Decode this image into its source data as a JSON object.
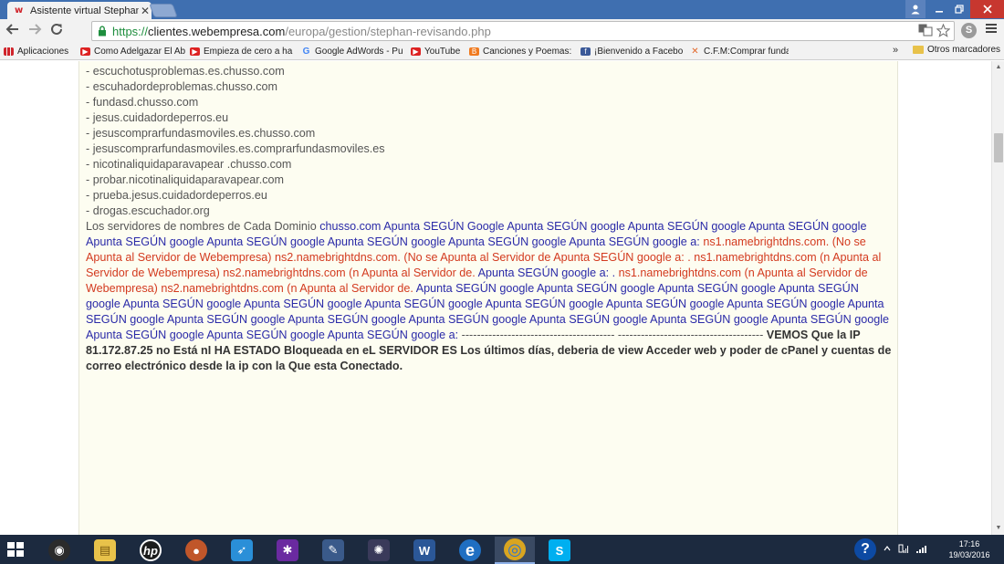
{
  "browser": {
    "tab_title": "Asistente virtual Stephan",
    "tab_close": "✕",
    "favicon": "w",
    "url_scheme": "https://",
    "url_host": "clientes.webempresa.com",
    "url_path": "/europa/gestion/stephan-revisando.php",
    "bookmarks": [
      {
        "label": "Aplicaciones",
        "icon": "apps-grid-icon"
      },
      {
        "label": "Como Adelgazar El Ab",
        "icon": "youtube-icon"
      },
      {
        "label": "Empieza de cero a ha",
        "icon": "youtube-icon"
      },
      {
        "label": "Google AdWords - Pu",
        "icon": "google-icon"
      },
      {
        "label": "YouTube",
        "icon": "youtube-icon"
      },
      {
        "label": "Canciones y Poemas:",
        "icon": "blogger-icon"
      },
      {
        "label": "¡Bienvenido a Facebo",
        "icon": "facebook-icon"
      },
      {
        "label": "C.F.M:Comprar funda",
        "icon": "cfm-icon"
      }
    ],
    "bookmarks_more": "»",
    "other_bookmarks": "Otros marcadores"
  },
  "content": {
    "list_items": [
      "- escuchotusproblemas.es.chusso.com",
      "- escuhadordeproblemas.chusso.com",
      "- fundasd.chusso.com",
      "- jesus.cuidadordeperros.eu",
      "- jesuscomprarfundasmoviles.es.chusso.com",
      "- jesuscomprarfundasmoviles.es.comprarfundasmoviles.es",
      "- nicotinaliquidaparavapear .chusso.com",
      "- probar.nicotinaliquidaparavapear.com",
      "- prueba.jesus.cuidadordeperros.eu",
      "- drogas.escuchador.org"
    ],
    "paragraph": [
      {
        "style": "grey",
        "text": "Los servidores de nombres de Cada Dominio "
      },
      {
        "style": "blue",
        "text": "chusso.com Apunta SEGÚN Google Apunta SEGÚN google Apunta SEGÚN google Apunta SEGÚN google Apunta SEGÚN google Apunta SEGÚN google Apunta SEGÚN google Apunta SEGÚN google Apunta SEGÚN google a: "
      },
      {
        "style": "red",
        "text": "ns1.namebrightdns.com. (No se Apunta al Servidor de Webempresa) ns2.namebrightdns.com. (No se Apunta al Servidor de Apunta SEGÚN google a: . ns1.namebrightdns.com (n Apunta al Servidor de Webempresa) ns2.namebrightdns.com (n Apunta al Servidor de. "
      },
      {
        "style": "blue",
        "text": "Apunta SEGÚN google a: . "
      },
      {
        "style": "red",
        "text": "ns1.namebrightdns.com (n Apunta al Servidor de Webempresa) ns2.namebrightdns.com (n Apunta al Servidor de. "
      },
      {
        "style": "blue",
        "text": "Apunta SEGÚN google Apunta SEGÚN google Apunta SEGÚN google Apunta SEGÚN google Apunta SEGÚN google Apunta SEGÚN google Apunta SEGÚN google Apunta SEGÚN google Apunta SEGÚN google Apunta SEGÚN google Apunta SEGÚN google Apunta SEGÚN google Apunta SEGÚN google Apunta SEGÚN google Apunta SEGÚN google Apunta SEGÚN google Apunta SEGÚN google Apunta SEGÚN google Apunta SEGÚN google Apunta SEGÚN google a: "
      },
      {
        "style": "grey",
        "text": "---------------------------------------- -------------------------------------- "
      },
      {
        "style": "bold",
        "text": "VEMOS Que la IP 81.172.87.25 no Está nI HA ESTADO Bloqueada en eL SERVIDOR ES Los últimos días, deberia de view Acceder web y poder de cPanel y cuentas de correo electrónico desde la ip con la Que esta Conectado."
      }
    ]
  },
  "taskbar": {
    "apps": [
      {
        "name": "media-player-icon",
        "glyph": "◉",
        "bg": "#2b2b2b"
      },
      {
        "name": "file-explorer-icon",
        "glyph": "▤",
        "bg": "#e8c24a"
      },
      {
        "name": "hp-icon",
        "glyph": "hp",
        "bg": "#1b1b1b"
      },
      {
        "name": "baseball-glove-icon",
        "glyph": "●",
        "bg": "#c0562a"
      },
      {
        "name": "rocket-icon",
        "glyph": "➶",
        "bg": "#2a8fd8"
      },
      {
        "name": "puzzle-game-icon",
        "glyph": "✱",
        "bg": "#6a2aa0"
      },
      {
        "name": "paint-palette-icon",
        "glyph": "✎",
        "bg": "#3a5a8a"
      },
      {
        "name": "pinwheel-icon",
        "glyph": "✺",
        "bg": "#3a3a5a"
      },
      {
        "name": "word-icon",
        "glyph": "W",
        "bg": "#2b5797"
      },
      {
        "name": "internet-explorer-icon",
        "glyph": "e",
        "bg": "#1f6fc2"
      },
      {
        "name": "chrome-icon",
        "glyph": "◎",
        "bg": "#d9a520"
      },
      {
        "name": "skype-icon",
        "glyph": "S",
        "bg": "#00aff0"
      }
    ],
    "time": "17:16",
    "date": "19/03/2016",
    "help_glyph": "?"
  }
}
